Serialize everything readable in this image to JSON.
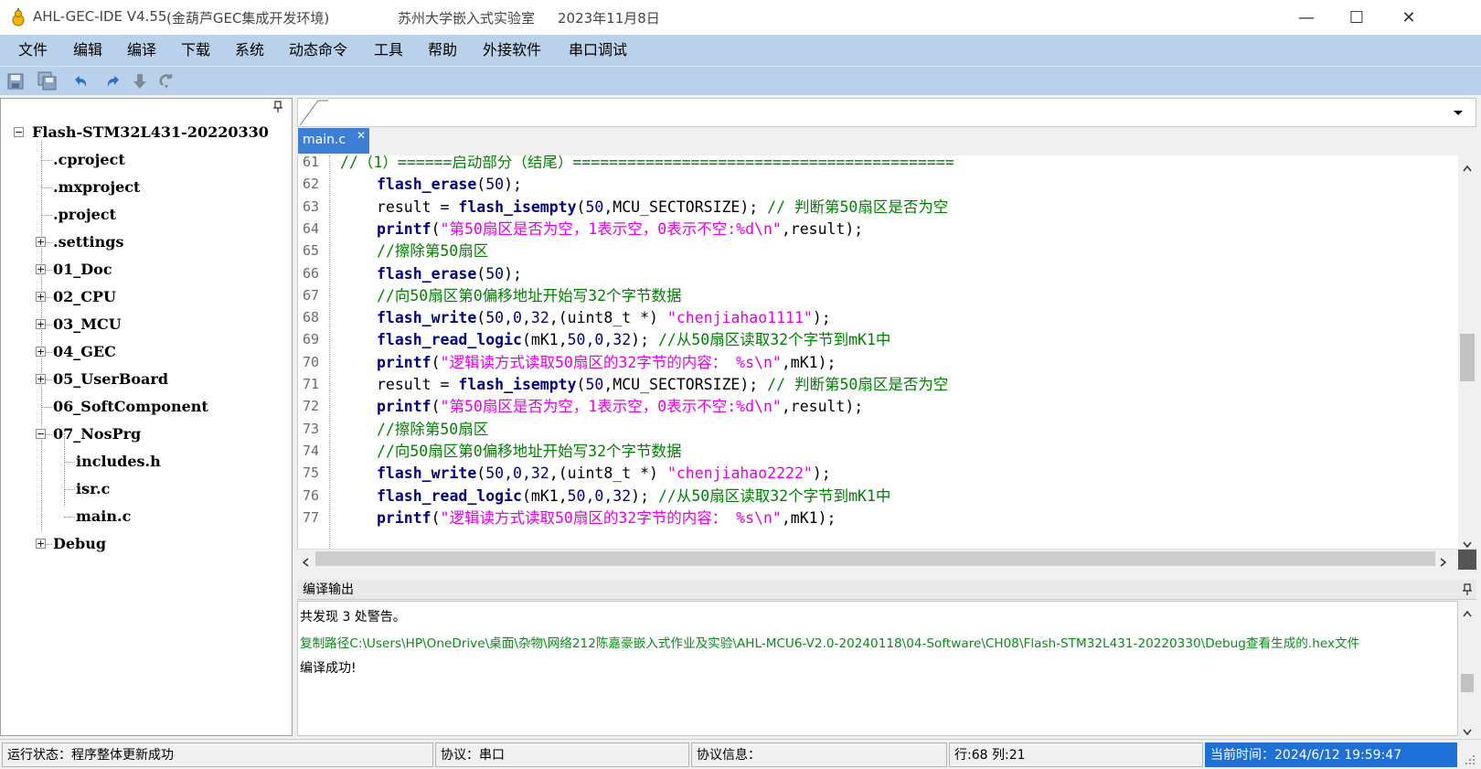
{
  "titlebar": {
    "app_name": "AHL-GEC-IDE V4.55",
    "subtitle": "(金葫芦GEC集成开发环境)",
    "publisher": "苏州大学嵌入式实验室",
    "date": "2023年11月8日",
    "minimize": "—",
    "maximize": "☐",
    "close": "✕"
  },
  "menu": [
    "文件",
    "编辑",
    "编译",
    "下载",
    "系统",
    "动态命令",
    "工具",
    "帮助",
    "外接软件",
    "串口调试"
  ],
  "toolbar": [
    "save-icon",
    "save-all-icon",
    "undo-icon",
    "redo-icon",
    "download-icon",
    "redo-alt-icon"
  ],
  "tree": {
    "pin": "📌",
    "root": "Flash-STM32L431-20220330",
    "items": [
      {
        "label": ".cproject",
        "level": 1,
        "expandable": false
      },
      {
        "label": ".mxproject",
        "level": 1,
        "expandable": false
      },
      {
        "label": ".project",
        "level": 1,
        "expandable": false
      },
      {
        "label": ".settings",
        "level": 1,
        "expandable": true
      },
      {
        "label": "01_Doc",
        "level": 1,
        "expandable": true
      },
      {
        "label": "02_CPU",
        "level": 1,
        "expandable": true
      },
      {
        "label": "03_MCU",
        "level": 1,
        "expandable": true
      },
      {
        "label": "04_GEC",
        "level": 1,
        "expandable": true
      },
      {
        "label": "05_UserBoard",
        "level": 1,
        "expandable": true
      },
      {
        "label": "06_SoftComponent",
        "level": 1,
        "expandable": false
      },
      {
        "label": "07_NosPrg",
        "level": 1,
        "expandable": true,
        "expanded": true
      },
      {
        "label": "includes.h",
        "level": 2,
        "expandable": false
      },
      {
        "label": "isr.c",
        "level": 2,
        "expandable": false
      },
      {
        "label": "main.c",
        "level": 2,
        "expandable": false
      },
      {
        "label": "Debug",
        "level": 1,
        "expandable": true
      }
    ]
  },
  "editor": {
    "tab": "main.c",
    "tab_close": "✕",
    "lines": [
      {
        "n": "61",
        "indent": 0,
        "parts": [
          [
            "cm",
            "//（1）======启动部分（结尾）=========================================="
          ]
        ]
      },
      {
        "n": "62",
        "indent": 1,
        "parts": [
          [
            "fn",
            "flash_erase"
          ],
          [
            "tx",
            "("
          ],
          [
            "nm",
            "50"
          ],
          [
            "tx",
            ");"
          ]
        ]
      },
      {
        "n": "63",
        "indent": 1,
        "parts": [
          [
            "tx",
            "result = "
          ],
          [
            "fn",
            "flash_isempty"
          ],
          [
            "tx",
            "("
          ],
          [
            "nm",
            "50"
          ],
          [
            "tx",
            ",MCU_SECTORSIZE); "
          ],
          [
            "cm",
            "// 判断第50扇区是否为空"
          ]
        ]
      },
      {
        "n": "64",
        "indent": 1,
        "parts": [
          [
            "fn",
            "printf"
          ],
          [
            "tx",
            "("
          ],
          [
            "st",
            "\"第50扇区是否为空，1表示空，0表示不空:%d\\n\""
          ],
          [
            "tx",
            ",result);"
          ]
        ]
      },
      {
        "n": "65",
        "indent": 1,
        "parts": [
          [
            "cm",
            "//擦除第50扇区"
          ]
        ]
      },
      {
        "n": "66",
        "indent": 1,
        "parts": [
          [
            "fn",
            "flash_erase"
          ],
          [
            "tx",
            "("
          ],
          [
            "nm",
            "50"
          ],
          [
            "tx",
            ");"
          ]
        ]
      },
      {
        "n": "67",
        "indent": 1,
        "parts": [
          [
            "cm",
            "//向50扇区第0偏移地址开始写32个字节数据"
          ]
        ]
      },
      {
        "n": "68",
        "indent": 1,
        "parts": [
          [
            "fn",
            "flash_write"
          ],
          [
            "tx",
            "("
          ],
          [
            "nm",
            "50,0,32"
          ],
          [
            "tx",
            ",(uint8_t *) "
          ],
          [
            "st",
            "\"chenjiahao1111\""
          ],
          [
            "tx",
            ");"
          ]
        ]
      },
      {
        "n": "69",
        "indent": 1,
        "parts": [
          [
            "fn",
            "flash_read_logic"
          ],
          [
            "tx",
            "(mK1,"
          ],
          [
            "nm",
            "50,0,32"
          ],
          [
            "tx",
            "); "
          ],
          [
            "cm",
            "//从50扇区读取32个字节到mK1中"
          ]
        ]
      },
      {
        "n": "70",
        "indent": 1,
        "parts": [
          [
            "fn",
            "printf"
          ],
          [
            "tx",
            "("
          ],
          [
            "st",
            "\"逻辑读方式读取50扇区的32字节的内容： %s\\n\""
          ],
          [
            "tx",
            ",mK1);"
          ]
        ]
      },
      {
        "n": "71",
        "indent": 1,
        "parts": [
          [
            "tx",
            "result = "
          ],
          [
            "fn",
            "flash_isempty"
          ],
          [
            "tx",
            "("
          ],
          [
            "nm",
            "50"
          ],
          [
            "tx",
            ",MCU_SECTORSIZE); "
          ],
          [
            "cm",
            "// 判断第50扇区是否为空"
          ]
        ]
      },
      {
        "n": "72",
        "indent": 1,
        "parts": [
          [
            "fn",
            "printf"
          ],
          [
            "tx",
            "("
          ],
          [
            "st",
            "\"第50扇区是否为空，1表示空，0表示不空:%d\\n\""
          ],
          [
            "tx",
            ",result);"
          ]
        ]
      },
      {
        "n": "73",
        "indent": 1,
        "parts": [
          [
            "cm",
            "//擦除第50扇区"
          ]
        ]
      },
      {
        "n": "74",
        "indent": 1,
        "parts": [
          [
            "cm",
            "//向50扇区第0偏移地址开始写32个字节数据"
          ]
        ]
      },
      {
        "n": "75",
        "indent": 1,
        "parts": [
          [
            "fn",
            "flash_write"
          ],
          [
            "tx",
            "("
          ],
          [
            "nm",
            "50,0,32"
          ],
          [
            "tx",
            ",(uint8_t *) "
          ],
          [
            "st",
            "\"chenjiahao2222\""
          ],
          [
            "tx",
            ");"
          ]
        ]
      },
      {
        "n": "76",
        "indent": 1,
        "parts": [
          [
            "fn",
            "flash_read_logic"
          ],
          [
            "tx",
            "(mK1,"
          ],
          [
            "nm",
            "50,0,32"
          ],
          [
            "tx",
            "); "
          ],
          [
            "cm",
            "//从50扇区读取32个字节到mK1中"
          ]
        ]
      },
      {
        "n": "77",
        "indent": 1,
        "parts": [
          [
            "fn",
            "printf"
          ],
          [
            "tx",
            "("
          ],
          [
            "st",
            "\"逻辑读方式读取50扇区的32字节的内容： %s\\n\""
          ],
          [
            "tx",
            ",mK1);"
          ]
        ]
      }
    ]
  },
  "output": {
    "title": "编译输出",
    "pin": "📌",
    "line1": "共发现 3 处警告。",
    "line2": "复制路径C:\\Users\\HP\\OneDrive\\桌面\\杂物\\网络212陈嘉豪嵌入式作业及实验\\AHL-MCU6-V2.0-20240118\\04-Software\\CH08\\Flash-STM32L431-20220330\\Debug查看生成的.hex文件",
    "line3": "编译成功!"
  },
  "status": {
    "run_state": "运行状态：程序整体更新成功",
    "protocol": "协议：串口",
    "protocol_info": "协议信息：",
    "position": "行:68 列:21",
    "time": "当前时间：2024/6/12 19:59:47"
  },
  "colors": {
    "menubar": "#b9d1ea",
    "tab_active": "#3c7fd4",
    "comment": "#008000",
    "string": "#e600e6",
    "keyword": "#000080",
    "status_time_bg": "#1e70d6"
  }
}
